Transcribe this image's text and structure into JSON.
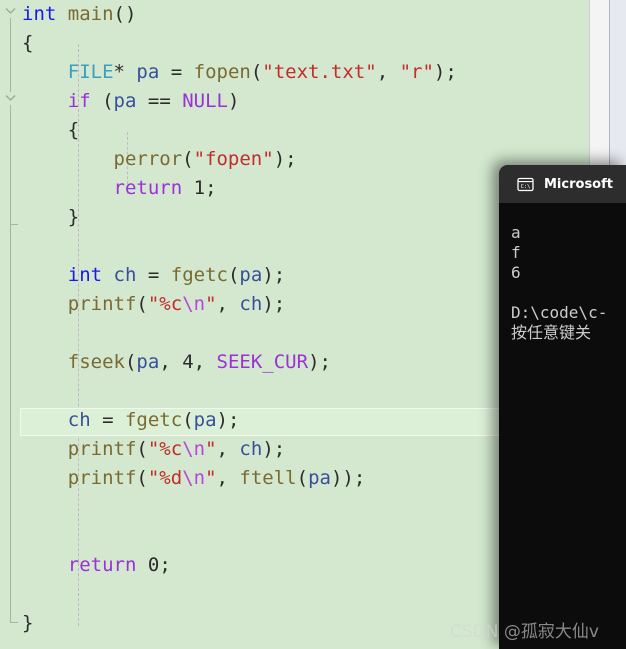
{
  "editor": {
    "background_color": "#d3e8cf",
    "current_line_index": 13,
    "fold_markers": [
      {
        "line": 0,
        "state": "expanded"
      },
      {
        "line": 3,
        "state": "expanded"
      }
    ],
    "lines": [
      {
        "index": 0,
        "text": "int main()",
        "tokens": [
          {
            "t": "int",
            "c": "kw"
          },
          {
            "t": " ",
            "c": "pun"
          },
          {
            "t": "main",
            "c": "fn"
          },
          {
            "t": "()",
            "c": "pun"
          }
        ]
      },
      {
        "index": 1,
        "text": "{",
        "tokens": [
          {
            "t": "{",
            "c": "pun"
          }
        ]
      },
      {
        "index": 2,
        "text": "    FILE* pa = fopen(\"text.txt\", \"r\");",
        "tokens": [
          {
            "t": "    ",
            "c": "pun"
          },
          {
            "t": "FILE",
            "c": "typ"
          },
          {
            "t": "* ",
            "c": "pun"
          },
          {
            "t": "pa",
            "c": "var"
          },
          {
            "t": " = ",
            "c": "pun"
          },
          {
            "t": "fopen",
            "c": "fn"
          },
          {
            "t": "(",
            "c": "pun"
          },
          {
            "t": "\"text.txt\"",
            "c": "str"
          },
          {
            "t": ", ",
            "c": "pun"
          },
          {
            "t": "\"r\"",
            "c": "str"
          },
          {
            "t": ");",
            "c": "pun"
          }
        ]
      },
      {
        "index": 3,
        "text": "    if (pa == NULL)",
        "tokens": [
          {
            "t": "    ",
            "c": "pun"
          },
          {
            "t": "if",
            "c": "kwp"
          },
          {
            "t": " (",
            "c": "pun"
          },
          {
            "t": "pa",
            "c": "var"
          },
          {
            "t": " == ",
            "c": "pun"
          },
          {
            "t": "NULL",
            "c": "kwp"
          },
          {
            "t": ")",
            "c": "pun"
          }
        ]
      },
      {
        "index": 4,
        "text": "    {",
        "tokens": [
          {
            "t": "    {",
            "c": "pun"
          }
        ]
      },
      {
        "index": 5,
        "text": "        perror(\"fopen\");",
        "tokens": [
          {
            "t": "        ",
            "c": "pun"
          },
          {
            "t": "perror",
            "c": "fn"
          },
          {
            "t": "(",
            "c": "pun"
          },
          {
            "t": "\"fopen\"",
            "c": "str"
          },
          {
            "t": ");",
            "c": "pun"
          }
        ]
      },
      {
        "index": 6,
        "text": "        return 1;",
        "tokens": [
          {
            "t": "        ",
            "c": "pun"
          },
          {
            "t": "return",
            "c": "kwp"
          },
          {
            "t": " ",
            "c": "pun"
          },
          {
            "t": "1",
            "c": "num"
          },
          {
            "t": ";",
            "c": "pun"
          }
        ]
      },
      {
        "index": 7,
        "text": "    }",
        "tokens": [
          {
            "t": "    }",
            "c": "pun"
          }
        ]
      },
      {
        "index": 8,
        "text": "",
        "tokens": []
      },
      {
        "index": 9,
        "text": "    int ch = fgetc(pa);",
        "tokens": [
          {
            "t": "    ",
            "c": "pun"
          },
          {
            "t": "int",
            "c": "kw"
          },
          {
            "t": " ",
            "c": "pun"
          },
          {
            "t": "ch",
            "c": "var"
          },
          {
            "t": " = ",
            "c": "pun"
          },
          {
            "t": "fgetc",
            "c": "fn"
          },
          {
            "t": "(",
            "c": "pun"
          },
          {
            "t": "pa",
            "c": "var"
          },
          {
            "t": ");",
            "c": "pun"
          }
        ]
      },
      {
        "index": 10,
        "text": "    printf(\"%c\\n\", ch);",
        "tokens": [
          {
            "t": "    ",
            "c": "pun"
          },
          {
            "t": "printf",
            "c": "fn"
          },
          {
            "t": "(",
            "c": "pun"
          },
          {
            "t": "\"%c",
            "c": "str"
          },
          {
            "t": "\\n",
            "c": "esc"
          },
          {
            "t": "\"",
            "c": "str"
          },
          {
            "t": ", ",
            "c": "pun"
          },
          {
            "t": "ch",
            "c": "var"
          },
          {
            "t": ");",
            "c": "pun"
          }
        ]
      },
      {
        "index": 11,
        "text": "",
        "tokens": []
      },
      {
        "index": 12,
        "text": "    fseek(pa, 4, SEEK_CUR);",
        "tokens": [
          {
            "t": "    ",
            "c": "pun"
          },
          {
            "t": "fseek",
            "c": "fn"
          },
          {
            "t": "(",
            "c": "pun"
          },
          {
            "t": "pa",
            "c": "var"
          },
          {
            "t": ", ",
            "c": "pun"
          },
          {
            "t": "4",
            "c": "num"
          },
          {
            "t": ", ",
            "c": "pun"
          },
          {
            "t": "SEEK_CUR",
            "c": "kwp"
          },
          {
            "t": ");",
            "c": "pun"
          }
        ]
      },
      {
        "index": 13,
        "text": "",
        "tokens": []
      },
      {
        "index": 14,
        "text": "    ch = fgetc(pa);",
        "tokens": [
          {
            "t": "    ",
            "c": "pun"
          },
          {
            "t": "ch",
            "c": "var"
          },
          {
            "t": " = ",
            "c": "pun"
          },
          {
            "t": "fgetc",
            "c": "fn"
          },
          {
            "t": "(",
            "c": "pun"
          },
          {
            "t": "pa",
            "c": "var"
          },
          {
            "t": ");",
            "c": "pun"
          }
        ]
      },
      {
        "index": 15,
        "text": "    printf(\"%c\\n\", ch);",
        "tokens": [
          {
            "t": "    ",
            "c": "pun"
          },
          {
            "t": "printf",
            "c": "fn"
          },
          {
            "t": "(",
            "c": "pun"
          },
          {
            "t": "\"%c",
            "c": "str"
          },
          {
            "t": "\\n",
            "c": "esc"
          },
          {
            "t": "\"",
            "c": "str"
          },
          {
            "t": ", ",
            "c": "pun"
          },
          {
            "t": "ch",
            "c": "var"
          },
          {
            "t": ");",
            "c": "pun"
          }
        ]
      },
      {
        "index": 16,
        "text": "    printf(\"%d\\n\", ftell(pa));",
        "tokens": [
          {
            "t": "    ",
            "c": "pun"
          },
          {
            "t": "printf",
            "c": "fn"
          },
          {
            "t": "(",
            "c": "pun"
          },
          {
            "t": "\"%d",
            "c": "str"
          },
          {
            "t": "\\n",
            "c": "esc"
          },
          {
            "t": "\"",
            "c": "str"
          },
          {
            "t": ", ",
            "c": "pun"
          },
          {
            "t": "ftell",
            "c": "fn"
          },
          {
            "t": "(",
            "c": "pun"
          },
          {
            "t": "pa",
            "c": "var"
          },
          {
            "t": "));",
            "c": "pun"
          }
        ]
      },
      {
        "index": 17,
        "text": "",
        "tokens": []
      },
      {
        "index": 18,
        "text": "",
        "tokens": []
      },
      {
        "index": 19,
        "text": "    return 0;",
        "tokens": [
          {
            "t": "    ",
            "c": "pun"
          },
          {
            "t": "return",
            "c": "kwp"
          },
          {
            "t": " ",
            "c": "pun"
          },
          {
            "t": "0",
            "c": "num"
          },
          {
            "t": ";",
            "c": "pun"
          }
        ]
      },
      {
        "index": 20,
        "text": "",
        "tokens": []
      },
      {
        "index": 21,
        "text": "}",
        "tokens": [
          {
            "t": "}",
            "c": "pun"
          }
        ]
      }
    ]
  },
  "console": {
    "icon": "command-prompt-icon",
    "title": "Microsoft ",
    "output_lines": [
      {
        "text": "a"
      },
      {
        "text": "f"
      },
      {
        "text": "6"
      },
      {
        "text": ""
      },
      {
        "text": "D:\\code\\c-"
      },
      {
        "text": "按任意键关"
      }
    ]
  },
  "watermark": {
    "text": "CSDN @孤寂大仙v"
  }
}
